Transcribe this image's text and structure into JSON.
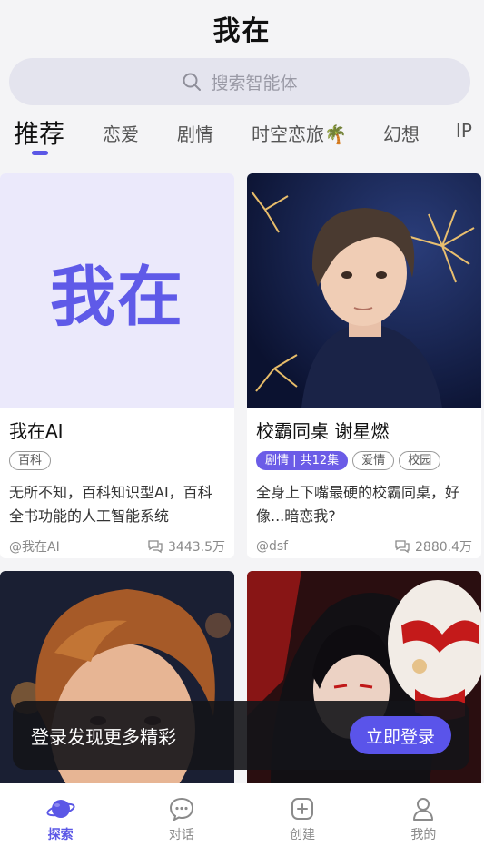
{
  "header": {
    "title": "我在"
  },
  "search": {
    "placeholder": "搜索智能体",
    "icon": "search-icon"
  },
  "tabs": [
    {
      "label": "推荐",
      "active": true
    },
    {
      "label": "恋爱",
      "active": false
    },
    {
      "label": "剧情",
      "active": false
    },
    {
      "label": "时空恋旅🌴",
      "active": false
    },
    {
      "label": "幻想",
      "active": false
    },
    {
      "label": "IP",
      "active": false
    }
  ],
  "cards": [
    {
      "title": "我在AI",
      "image_text": "我在",
      "tags": [
        "百科"
      ],
      "description": "无所不知，百科知识型AI，百科全书功能的人工智能系统",
      "author": "@我在AI",
      "count": "3443.5万"
    },
    {
      "title": "校霸同桌 谢星燃",
      "tags": [
        "剧情 | 共12集",
        "爱情",
        "校园"
      ],
      "description": "全身上下嘴最硬的校霸同桌，好像...暗恋我?",
      "author": "@dsf",
      "count": "2880.4万"
    }
  ],
  "login_banner": {
    "text": "登录发现更多精彩",
    "button": "立即登录"
  },
  "bottom_nav": [
    {
      "label": "探索",
      "icon": "planet-icon",
      "active": true
    },
    {
      "label": "对话",
      "icon": "chat-bubble-icon",
      "active": false
    },
    {
      "label": "创建",
      "icon": "plus-square-icon",
      "active": false
    },
    {
      "label": "我的",
      "icon": "user-icon",
      "active": false
    }
  ],
  "colors": {
    "accent": "#5b57e6",
    "card_bg": "#ebe9fb",
    "logo": "#5f5ae8"
  }
}
